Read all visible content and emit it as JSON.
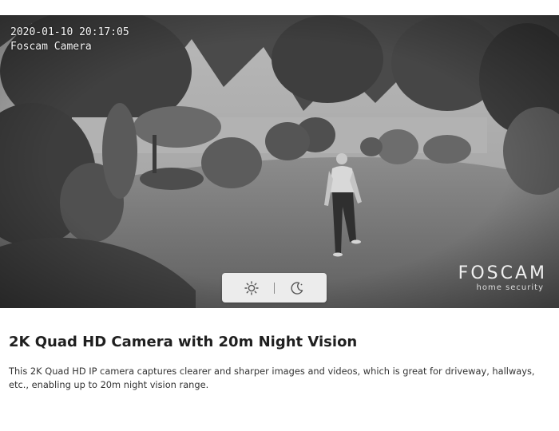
{
  "camera": {
    "timestamp": "2020-01-10 20:17:05",
    "camera_name": "Foscam Camera",
    "watermark_brand": "FOSCAM",
    "watermark_tagline": "home security"
  },
  "mode_toggle": {
    "day_icon": "sun-icon",
    "night_icon": "moon-icon"
  },
  "feature": {
    "title": "2K Quad HD Camera with 20m Night Vision",
    "description": "This 2K Quad HD IP camera captures clearer and sharper images and videos, which is great for driveway, hallways, etc., enabling up to 20m night vision range."
  },
  "colors": {
    "page_background": "#ffffff",
    "toggle_background": "#ececec",
    "text": "#222222"
  }
}
